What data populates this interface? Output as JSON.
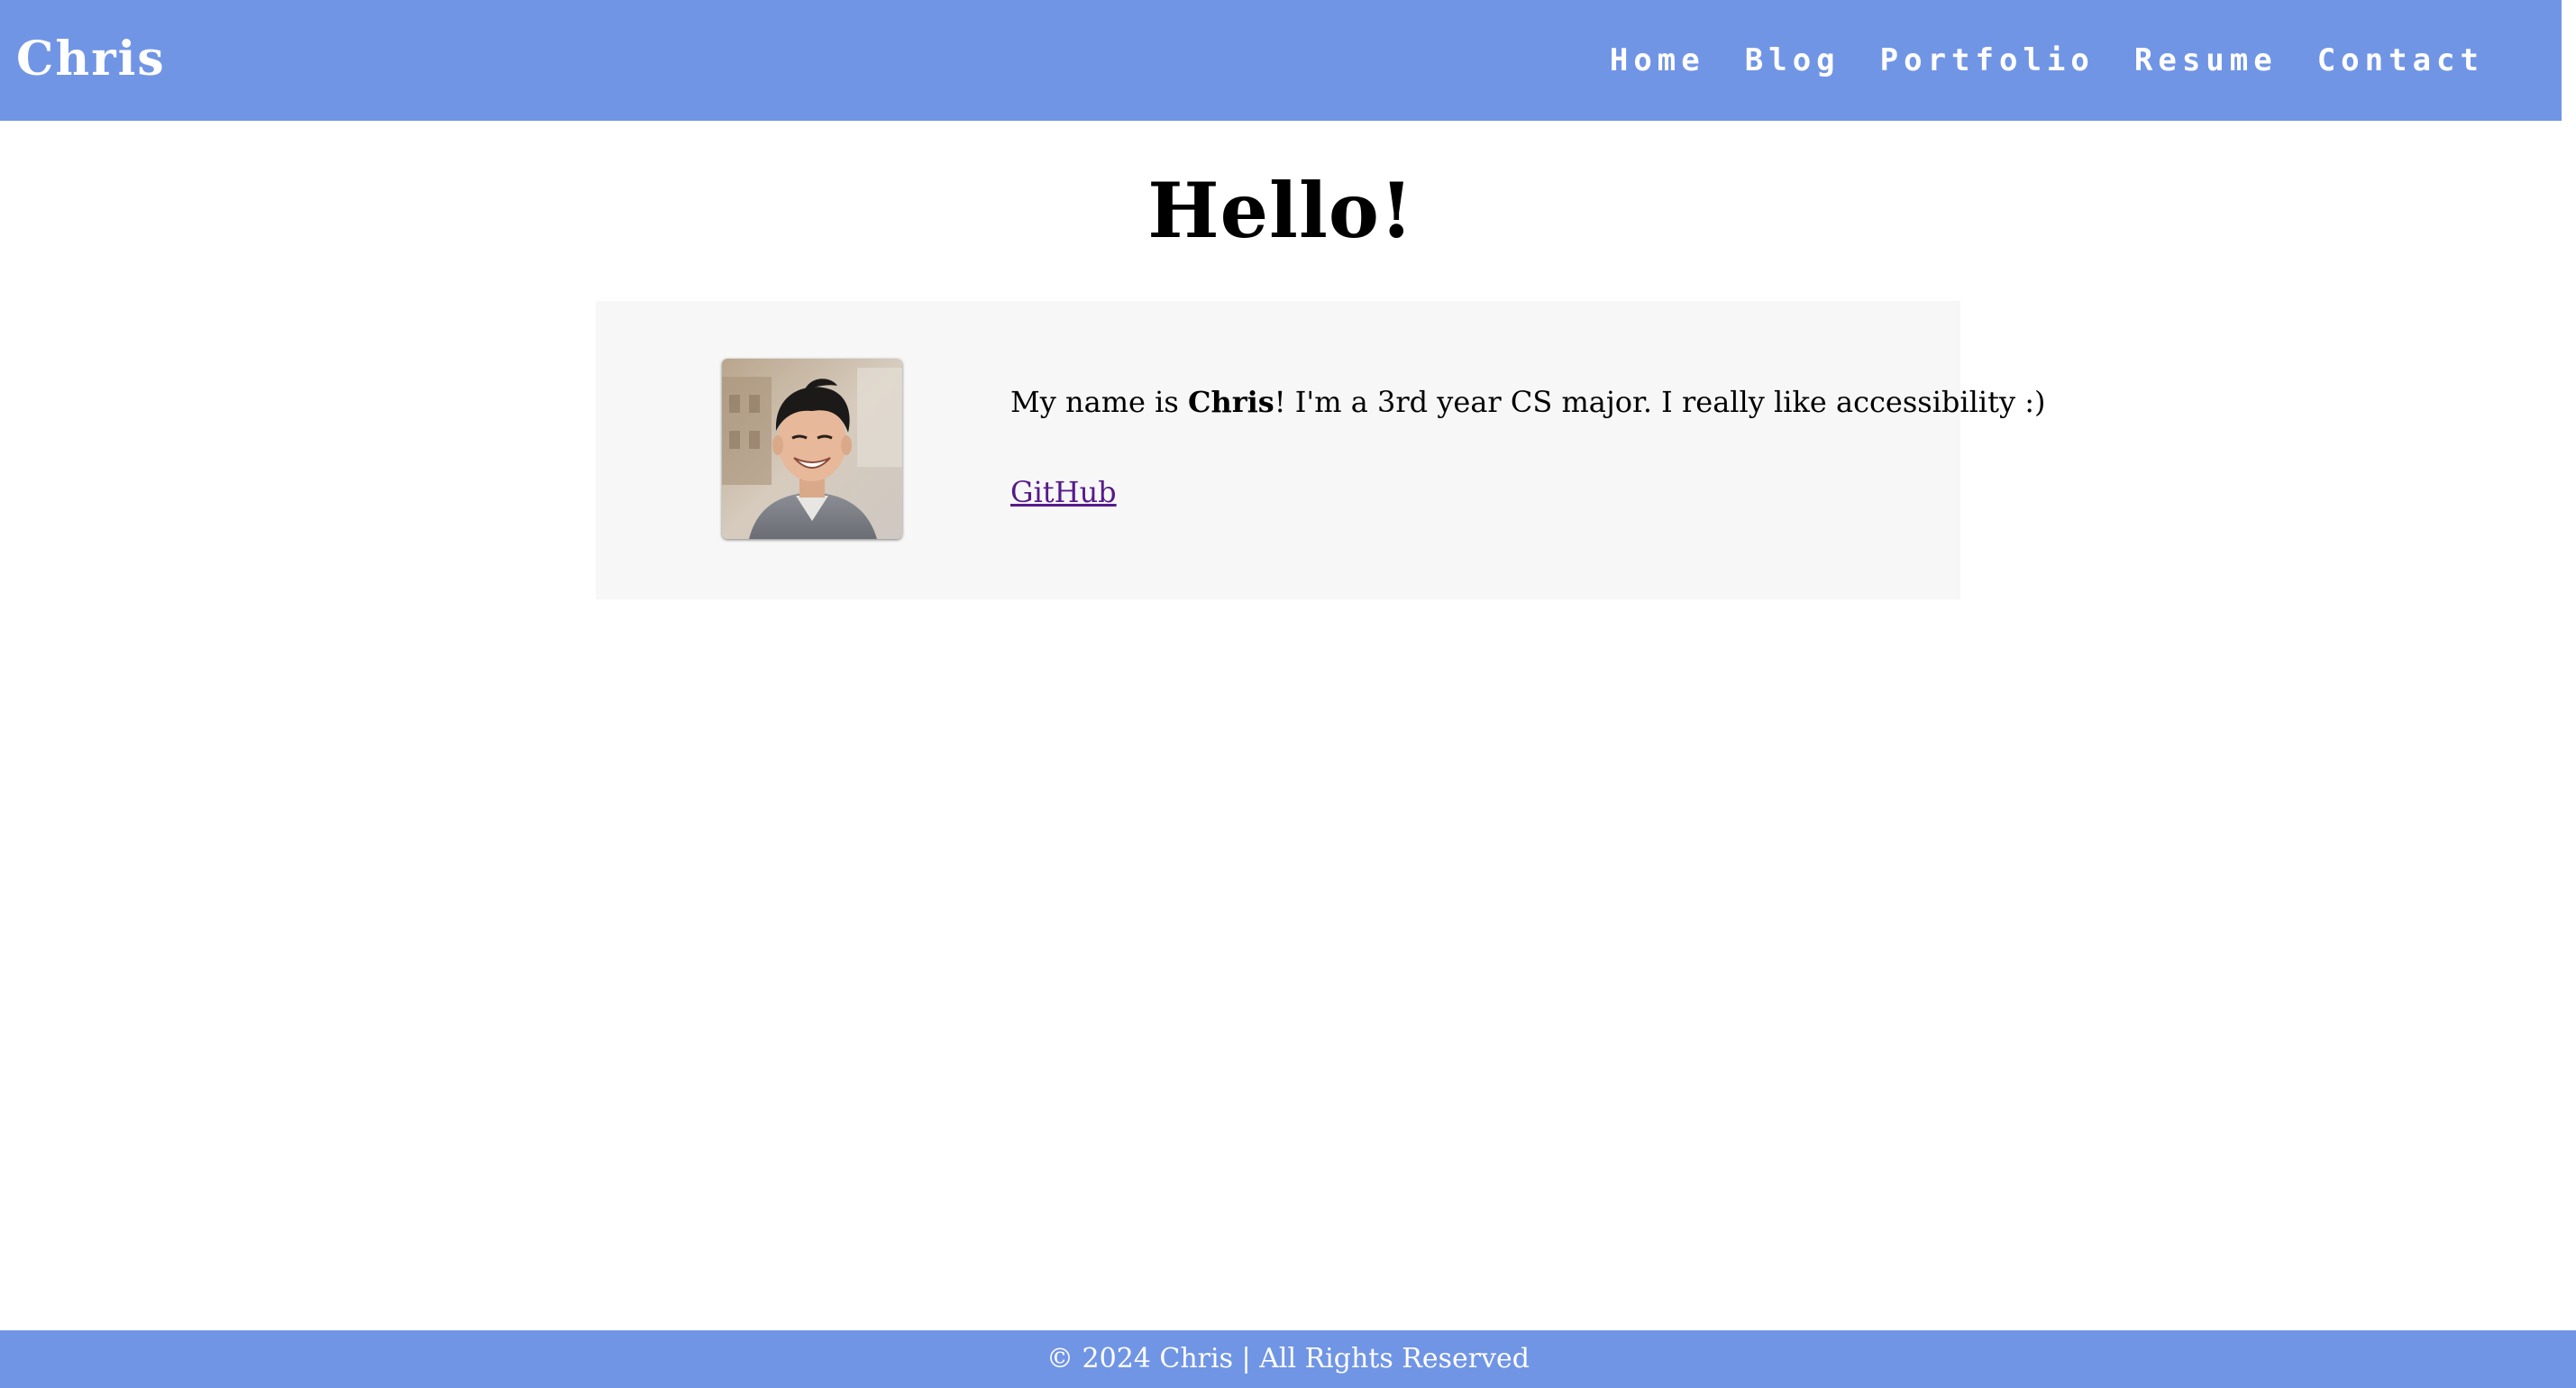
{
  "header": {
    "brand": "Chris",
    "nav": [
      {
        "label": "Home"
      },
      {
        "label": "Blog"
      },
      {
        "label": "Portfolio"
      },
      {
        "label": "Resume"
      },
      {
        "label": "Contact"
      }
    ]
  },
  "main": {
    "title": "Hello!",
    "about": {
      "bio_prefix": "My name is ",
      "bio_name": "Chris",
      "bio_suffix": "! I'm a 3rd year CS major. I really like accessibility :)",
      "github_label": "GitHub",
      "avatar_alt": "Photo of Chris"
    }
  },
  "footer": {
    "text": "© 2024 Chris | All Rights Reserved"
  },
  "colors": {
    "header_bg": "#7195e5",
    "footer_bg": "#7195e5",
    "card_bg": "#f7f7f7",
    "link_visited": "#551a8b"
  }
}
